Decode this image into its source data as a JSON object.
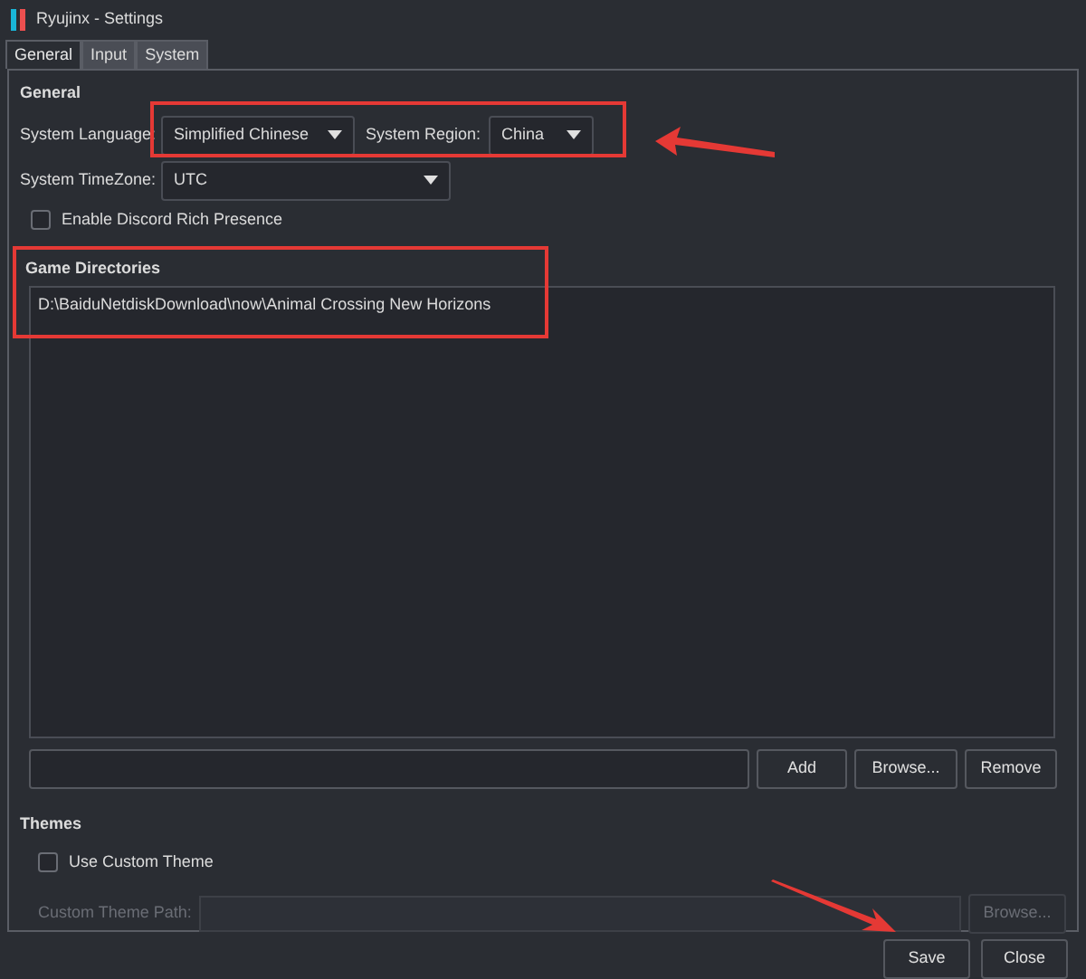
{
  "window": {
    "title": "Ryujinx - Settings"
  },
  "tabs": [
    {
      "label": "General",
      "selected": true
    },
    {
      "label": "Input",
      "selected": false
    },
    {
      "label": "System",
      "selected": false
    }
  ],
  "general": {
    "heading": "General",
    "language": {
      "label": "System Language:",
      "value": "Simplified Chinese"
    },
    "region": {
      "label": "System Region:",
      "value": "China"
    },
    "timezone": {
      "label": "System TimeZone:",
      "value": "UTC"
    },
    "discord": {
      "label": "Enable Discord Rich Presence",
      "checked": false
    }
  },
  "game_directories": {
    "heading": "Game Directories",
    "items": [
      {
        "path": "D:\\BaiduNetdiskDownload\\now\\Animal Crossing New Horizons"
      }
    ],
    "buttons": [
      "Add",
      "Browse...",
      "Remove"
    ]
  },
  "themes": {
    "heading": "Themes",
    "custom_theme": {
      "label": "Use Custom Theme",
      "checked": false
    },
    "theme_path": {
      "label": "Custom Theme Path:",
      "disabled": true
    },
    "browse": {
      "label": "Browse...",
      "disabled": true
    }
  },
  "footer_buttons": [
    "Save",
    "Close"
  ]
}
